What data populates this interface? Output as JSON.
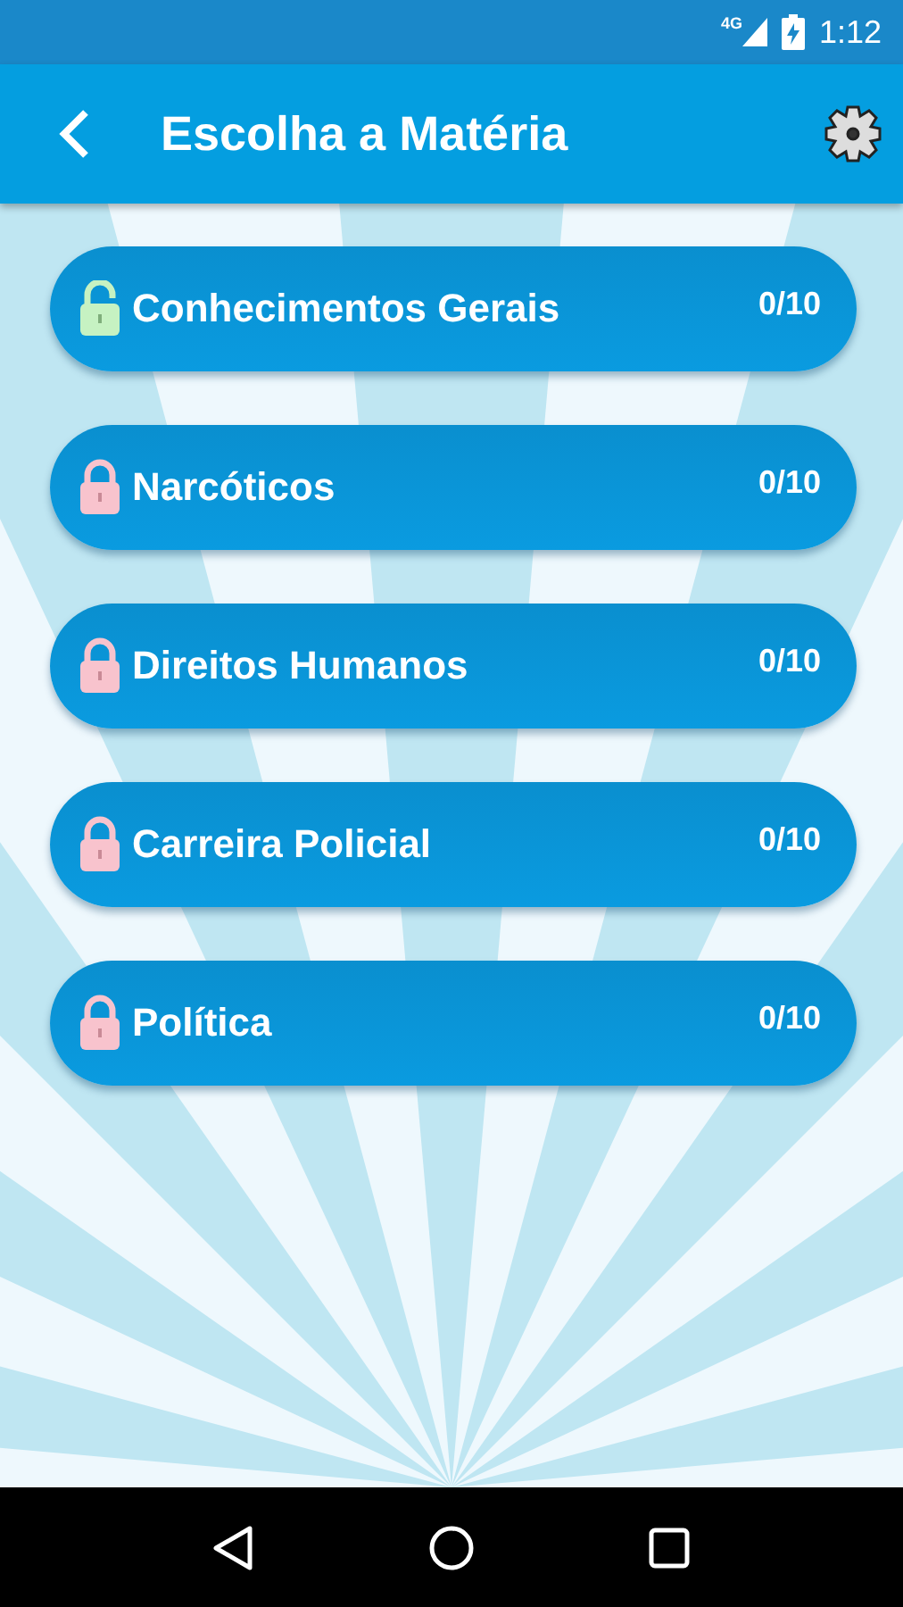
{
  "status_bar": {
    "network": "4G",
    "time": "1:12"
  },
  "app_bar": {
    "title": "Escolha a Matéria"
  },
  "subjects": [
    {
      "name": "Conhecimentos Gerais",
      "score": "0/10",
      "locked": false
    },
    {
      "name": "Narcóticos",
      "score": "0/10",
      "locked": true
    },
    {
      "name": "Direitos Humanos",
      "score": "0/10",
      "locked": true
    },
    {
      "name": "Carreira Policial",
      "score": "0/10",
      "locked": true
    },
    {
      "name": "Política",
      "score": "0/10",
      "locked": true
    }
  ]
}
